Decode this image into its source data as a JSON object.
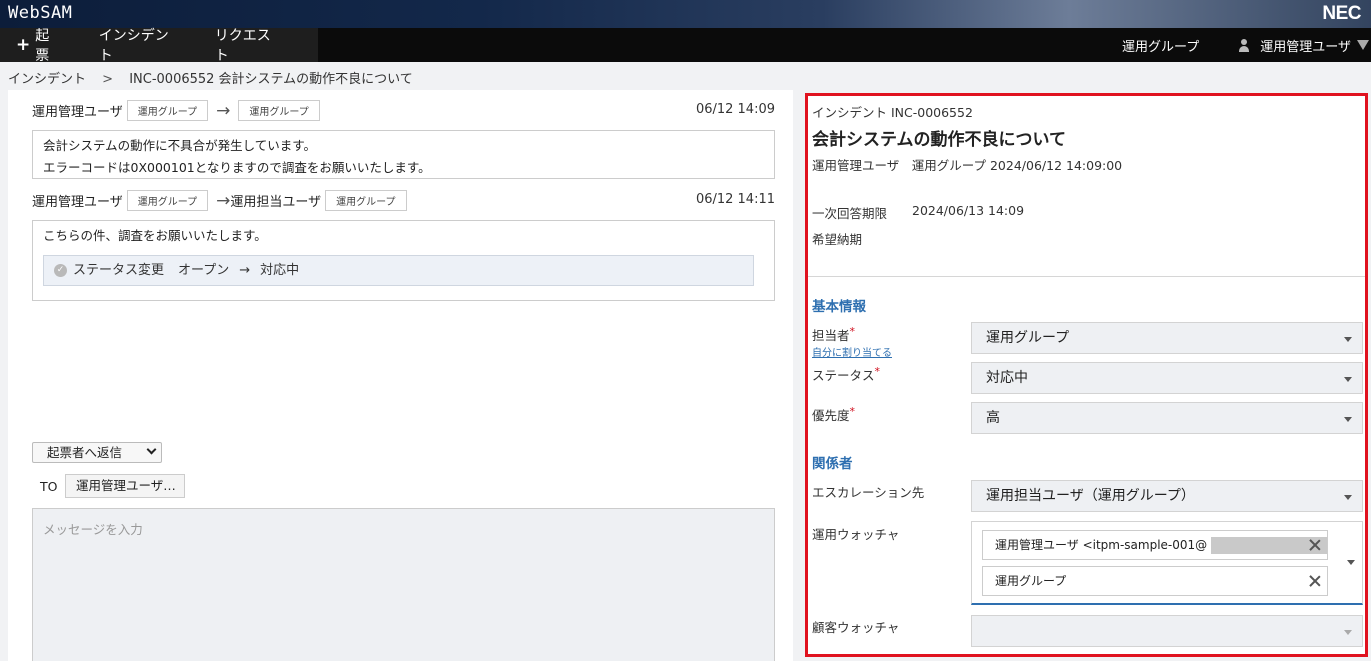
{
  "app": {
    "name": "WebSAM",
    "brand": "NEC"
  },
  "nav": {
    "create_label": "起票",
    "items": [
      "インシデント",
      "リクエスト"
    ],
    "group_label": "運用グループ",
    "user_label": "運用管理ユーザ"
  },
  "breadcrumb": {
    "root": "インシデント",
    "separator": ">",
    "current": "INC-0006552 会計システムの動作不良について"
  },
  "messages": [
    {
      "from": "運用管理ユーザ",
      "from_tag": "運用グループ",
      "to_tag": "運用グループ",
      "timestamp": "06/12 14:09",
      "lines": [
        "会計システムの動作に不具合が発生しています。",
        "エラーコードは0X000101となりますので調査をお願いいたします。"
      ]
    },
    {
      "from": "運用管理ユーザ",
      "from_tag": "運用グループ",
      "to_user": "運用担当ユーザ",
      "to_tag": "運用グループ",
      "timestamp": "06/12 14:11",
      "text": "こちらの件、調査をお願いいたします。",
      "status_change": {
        "label": "ステータス変更",
        "from": "オープン",
        "to": "対応中"
      }
    }
  ],
  "reply": {
    "mode": "起票者へ返信",
    "to_label": "TO",
    "to_value": "運用管理ユーザ…",
    "placeholder": "メッセージを入力"
  },
  "incident": {
    "id_line": "インシデント INC-0006552",
    "title": "会計システムの動作不良について",
    "meta": "運用管理ユーザ　運用グループ 2024/06/12 14:09:00",
    "first_response_label": "一次回答期限",
    "first_response_value": "2024/06/13 14:09",
    "desired_due_label": "希望納期"
  },
  "basic_info": {
    "heading": "基本情報",
    "assignee_label": "担当者",
    "assign_self_link": "自分に割り当てる",
    "assignee_value": "運用グループ",
    "status_label": "ステータス",
    "status_value": "対応中",
    "priority_label": "優先度",
    "priority_value": "高"
  },
  "related": {
    "heading": "関係者",
    "escalation_label": "エスカレーション先",
    "escalation_value": "運用担当ユーザ（運用グループ）",
    "ops_watcher_label": "運用ウォッチャ",
    "ops_watchers": [
      "運用管理ユーザ <itpm-sample-001@",
      "運用グループ"
    ],
    "customer_watcher_label": "顧客ウォッチャ"
  },
  "colors": {
    "highlight_border": "#e0121f",
    "section_heading": "#2e6fb0",
    "required_mark": "#d0101f"
  }
}
